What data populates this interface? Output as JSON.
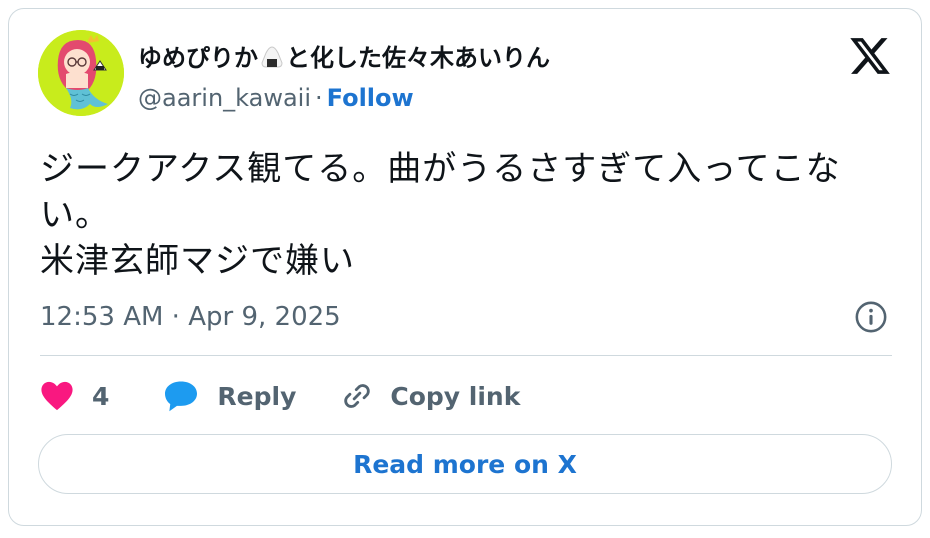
{
  "author": {
    "name_part1": "ゆめぴりか",
    "name_part2": "と化した佐々木あいりん",
    "handle": "@aarin_kawaii",
    "separator": "·",
    "follow_label": "Follow"
  },
  "tweet": {
    "text": "ジークアクス観てる。曲がうるさすぎて入ってこない。\n米津玄師マジで嫌い",
    "timestamp": "12:53 AM · Apr 9, 2025"
  },
  "actions": {
    "like_count": "4",
    "reply_label": "Reply",
    "copy_label": "Copy link"
  },
  "read_more_label": "Read more on X",
  "colors": {
    "like": "#f91880",
    "reply": "#1d9bf0",
    "link": "#1d74d0",
    "muted": "#536471",
    "avatar_bg": "#c8ec1c"
  },
  "icons": [
    "x-logo-icon",
    "info-icon",
    "heart-icon",
    "speech-bubble-icon",
    "link-icon",
    "onigiri-emoji-icon"
  ]
}
